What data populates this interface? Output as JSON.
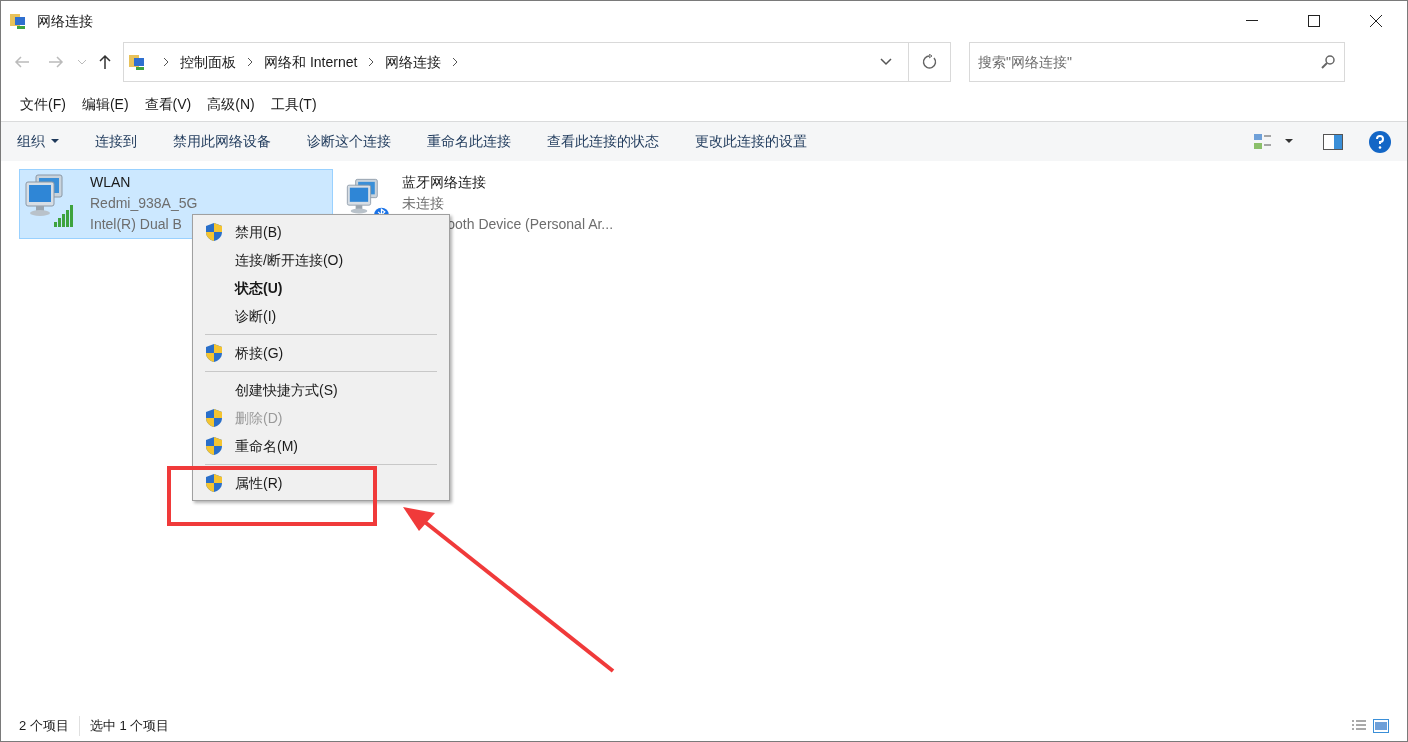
{
  "window": {
    "title": "网络连接"
  },
  "address": {
    "crumbs": [
      "控制面板",
      "网络和 Internet",
      "网络连接"
    ]
  },
  "search": {
    "placeholder": "搜索\"网络连接\""
  },
  "menu_bar": [
    "文件(F)",
    "编辑(E)",
    "查看(V)",
    "高级(N)",
    "工具(T)"
  ],
  "command_bar": [
    {
      "label": "组织",
      "dropdown": true
    },
    {
      "label": "连接到",
      "dropdown": false
    },
    {
      "label": "禁用此网络设备",
      "dropdown": false
    },
    {
      "label": "诊断这个连接",
      "dropdown": false
    },
    {
      "label": "重命名此连接",
      "dropdown": false
    },
    {
      "label": "查看此连接的状态",
      "dropdown": false
    },
    {
      "label": "更改此连接的设置",
      "dropdown": false
    }
  ],
  "connections": [
    {
      "kind": "wifi",
      "name": "WLAN",
      "status": "Redmi_938A_5G",
      "device": "Intel(R) Dual B",
      "selected": true
    },
    {
      "kind": "bluetooth",
      "name": "蓝牙网络连接",
      "status": "未连接",
      "device": "ooth Device (Personal Ar...",
      "selected": false
    }
  ],
  "context_menu": [
    {
      "label": "禁用(B)",
      "shield": true,
      "bold": false,
      "disabled": false,
      "separator_after": false
    },
    {
      "label": "连接/断开连接(O)",
      "shield": false,
      "bold": false,
      "disabled": false,
      "separator_after": false
    },
    {
      "label": "状态(U)",
      "shield": false,
      "bold": true,
      "disabled": false,
      "separator_after": false
    },
    {
      "label": "诊断(I)",
      "shield": false,
      "bold": false,
      "disabled": false,
      "separator_after": true
    },
    {
      "label": "桥接(G)",
      "shield": true,
      "bold": false,
      "disabled": false,
      "separator_after": true
    },
    {
      "label": "创建快捷方式(S)",
      "shield": false,
      "bold": false,
      "disabled": false,
      "separator_after": false
    },
    {
      "label": "删除(D)",
      "shield": true,
      "bold": false,
      "disabled": true,
      "separator_after": false
    },
    {
      "label": "重命名(M)",
      "shield": true,
      "bold": false,
      "disabled": false,
      "separator_after": true
    },
    {
      "label": "属性(R)",
      "shield": true,
      "bold": false,
      "disabled": false,
      "separator_after": false
    }
  ],
  "status_bar": [
    "2 个项目",
    "选中 1 个项目"
  ]
}
